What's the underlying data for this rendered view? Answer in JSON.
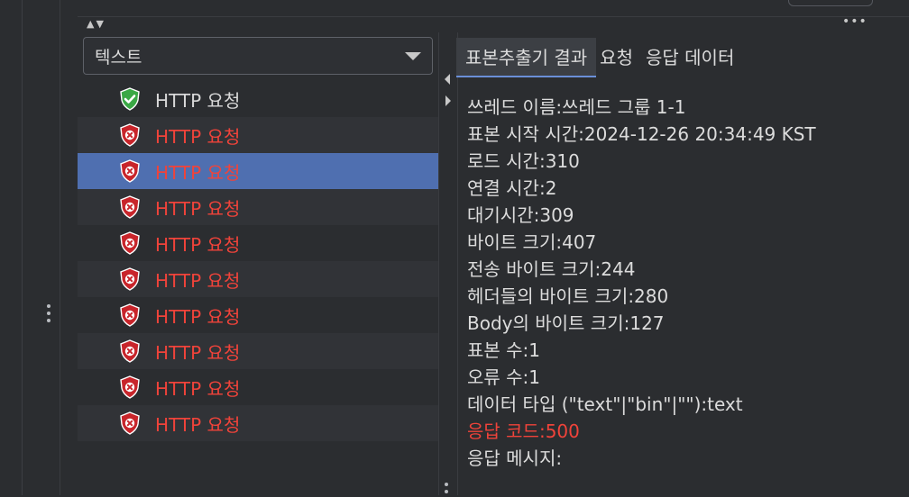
{
  "sampler_list": {
    "filter_label": "텍스트",
    "items": [
      {
        "label": "HTTP 요청",
        "status": "success"
      },
      {
        "label": "HTTP 요청",
        "status": "error"
      },
      {
        "label": "HTTP 요청",
        "status": "error",
        "selected": true
      },
      {
        "label": "HTTP 요청",
        "status": "error"
      },
      {
        "label": "HTTP 요청",
        "status": "error"
      },
      {
        "label": "HTTP 요청",
        "status": "error"
      },
      {
        "label": "HTTP 요청",
        "status": "error"
      },
      {
        "label": "HTTP 요청",
        "status": "error"
      },
      {
        "label": "HTTP 요청",
        "status": "error"
      },
      {
        "label": "HTTP 요청",
        "status": "error"
      }
    ]
  },
  "detail": {
    "tabs": [
      {
        "label": "표본추출기 결과",
        "active": true
      },
      {
        "label": "요청",
        "active": false
      },
      {
        "label": "응답 데이터",
        "active": false
      }
    ],
    "lines": [
      "쓰레드 이름:쓰레드 그룹 1-1",
      "표본 시작 시간:2024-12-26 20:34:49 KST",
      "로드 시간:310",
      "연결 시간:2",
      "대기시간:309",
      "바이트 크기:407",
      "전송 바이트 크기:244",
      "헤더들의 바이트 크기:280",
      "Body의 바이트 크기:127",
      "표본 수:1",
      "오류 수:1",
      "데이터 타입 (\"text\"|\"bin\"|\"\"):text",
      "응답 코드:500",
      "응답 메시지:"
    ],
    "error_line_index": 12
  },
  "colors": {
    "background": "#2b2d30",
    "selection": "#4f6fb0",
    "error_text": "#f0433a",
    "success_icon": "#3aa845",
    "error_icon": "#c8252b"
  },
  "icons": {
    "success": "shield-check-icon",
    "error": "shield-x-icon"
  }
}
